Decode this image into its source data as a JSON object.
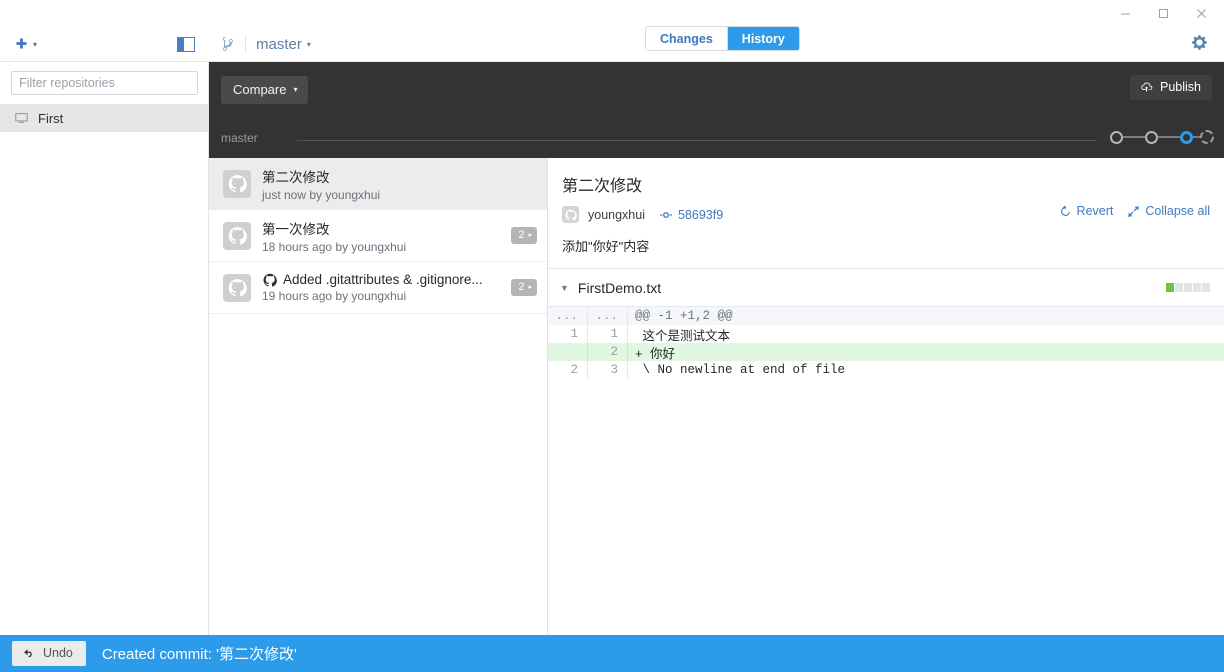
{
  "window": {
    "minimize_label": "Minimize",
    "maximize_label": "Maximize",
    "close_label": "Close"
  },
  "sidebar": {
    "add_label": "+",
    "add_caret": "▾",
    "panel_toggle_name": "toggle-sidebar",
    "filter": {
      "placeholder": "Filter repositories",
      "value": ""
    },
    "repositories": [
      {
        "name": "First",
        "selected": true
      }
    ]
  },
  "header": {
    "branch": {
      "name": "master",
      "caret": "▾"
    },
    "tabs": [
      {
        "label": "Changes",
        "active": false
      },
      {
        "label": "History",
        "active": true
      }
    ],
    "settings_label": "Settings"
  },
  "toolbar": {
    "compare_label": "Compare",
    "compare_caret": "▾",
    "publish_label": "Publish",
    "timeline_label": "master",
    "nodes": [
      {
        "type": "solid"
      },
      {
        "type": "solid"
      },
      {
        "type": "selected"
      },
      {
        "type": "dashed"
      }
    ]
  },
  "commits": [
    {
      "title": "第二次修改",
      "subtitle": "just now by youngxhui",
      "badge": "",
      "selected": true,
      "has_octocat": false
    },
    {
      "title": "第一次修改",
      "subtitle": "18 hours ago by youngxhui",
      "badge": "2",
      "badge_caret": "▸",
      "selected": false,
      "has_octocat": false
    },
    {
      "title": "Added .gitattributes & .gitignore...",
      "subtitle": "19 hours ago by youngxhui",
      "badge": "2",
      "badge_caret": "▸",
      "selected": false,
      "has_octocat": true
    }
  ],
  "detail": {
    "title": "第二次修改",
    "author": "youngxhui",
    "sha": "58693f9",
    "description": "添加\"你好\"内容",
    "revert_label": "Revert",
    "collapse_label": "Collapse all",
    "file": {
      "name": "FirstDemo.txt",
      "expand_caret": "▼",
      "blocks": [
        "add",
        "empty",
        "empty",
        "empty",
        "empty"
      ]
    },
    "diff_rows": [
      {
        "type": "hunk",
        "old": "...",
        "new": "...",
        "text": "@@ -1 +1,2 @@"
      },
      {
        "type": "ctx",
        "old": "1",
        "new": "1",
        "text": " 这个是测试文本"
      },
      {
        "type": "add",
        "old": "",
        "new": "2",
        "text": "+ 你好"
      },
      {
        "type": "ctx",
        "old": "2",
        "new": "3",
        "text": " \\ No newline at end of file"
      }
    ]
  },
  "statusbar": {
    "undo_label": "Undo",
    "message": "Created commit: '第二次修改'"
  },
  "colors": {
    "accent": "#2b9bea",
    "link": "#4078c0",
    "dark_toolbar": "#333333",
    "add_green": "#6cc644",
    "add_row_bg": "#e0f7e0"
  }
}
